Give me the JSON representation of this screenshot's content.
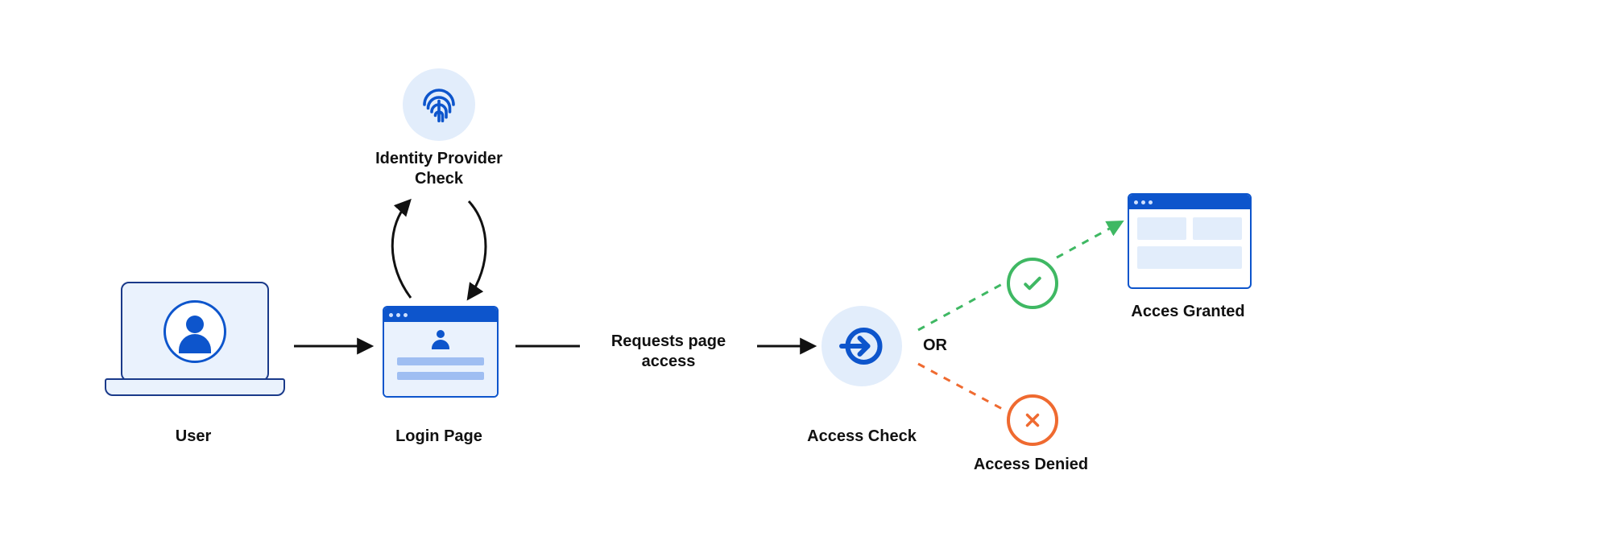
{
  "nodes": {
    "user_label": "User",
    "login_label": "Login Page",
    "idp_label": "Identity Provider\nCheck",
    "request_label": "Requests page\naccess",
    "access_check_label": "Access Check",
    "or_label": "OR",
    "granted_label": "Acces Granted",
    "denied_label": "Access Denied"
  },
  "colors": {
    "primary": "#0d55cc",
    "pale_bg": "#e2edfb",
    "field": "#9fbef2",
    "success": "#3fb863",
    "error": "#ef6a30",
    "black": "#111111"
  },
  "icons": {
    "user": "user-avatar-icon",
    "fingerprint": "fingerprint-icon",
    "access": "login-arrow-icon",
    "check": "checkmark-icon",
    "cross": "cross-icon"
  }
}
